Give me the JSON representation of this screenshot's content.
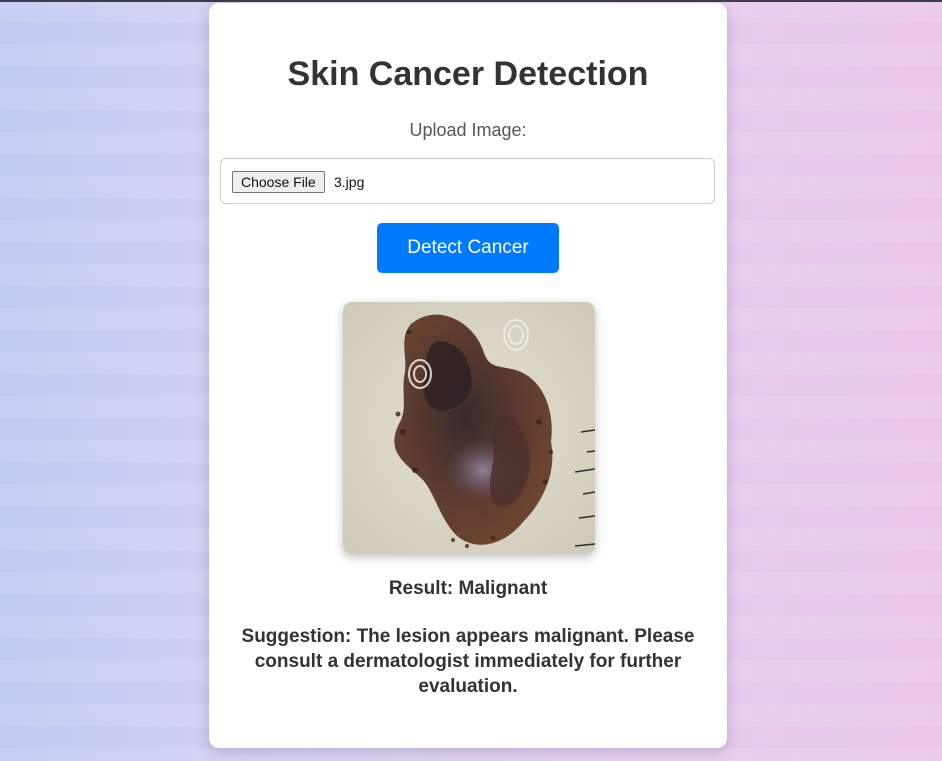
{
  "page": {
    "title": "Skin Cancer Detection",
    "upload_label": "Upload Image:",
    "file_input": {
      "button_label": "Choose File",
      "file_name": "3.jpg"
    },
    "detect_button_label": "Detect Cancer",
    "result_text": "Result: Malignant",
    "suggestion_text": "Suggestion: The lesion appears malignant. Please consult a dermatologist immediately for further evaluation."
  },
  "colors": {
    "accent": "#007bff",
    "text": "#333333",
    "card": "#ffffff"
  },
  "icons": {
    "preview": "skin-lesion-image"
  }
}
